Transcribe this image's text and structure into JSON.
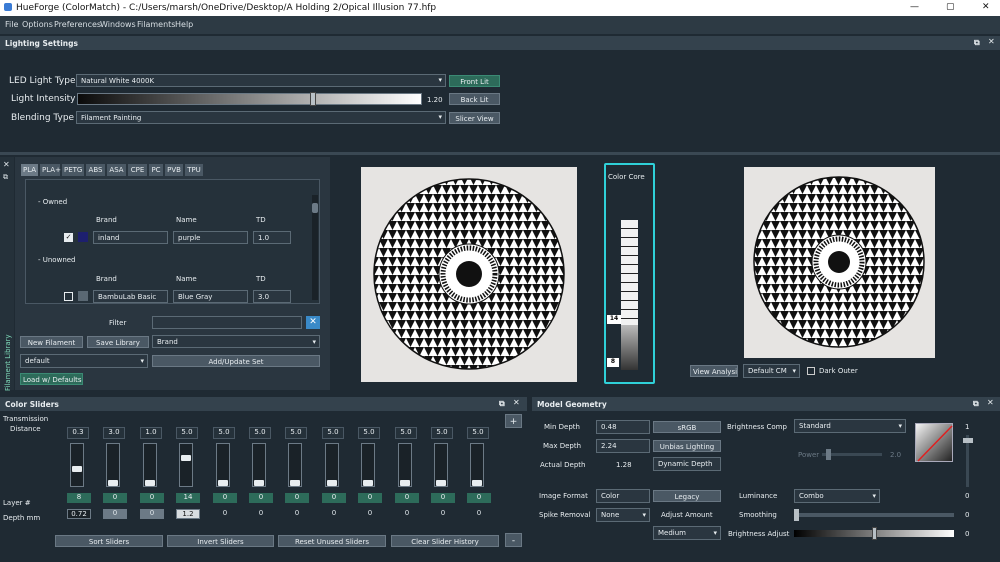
{
  "window": {
    "title": "HueForge (ColorMatch) - C:/Users/marsh/OneDrive/Desktop/A Holding 2/Opical Illusion 77.hfp",
    "minimize": "—",
    "maximize": "▢",
    "close": "✕"
  },
  "menu": [
    "File",
    "Options",
    "Preferences",
    "Windows",
    "Filaments",
    "Help"
  ],
  "lighting": {
    "header": "Lighting Settings",
    "led_label": "LED Light Type",
    "led_value": "Natural White 4000K",
    "intensity_label": "Light Intensity",
    "intensity_value": "1.20",
    "intensity_fraction": 0.68,
    "blending_label": "Blending Type",
    "blending_value": "Filament Painting",
    "btn_front": "Front Lit",
    "btn_back": "Back Lit",
    "btn_slicer": "Slicer View"
  },
  "library": {
    "side_label": "Filament Library",
    "tabs": [
      "PLA",
      "PLA+",
      "PETG",
      "ABS",
      "ASA",
      "CPE",
      "PC",
      "PVB",
      "TPU"
    ],
    "owned": "- Owned",
    "unowned": "- Unowned",
    "col_brand": "Brand",
    "col_name": "Name",
    "col_td": "TD",
    "owned_row": {
      "brand": "inland",
      "name": "purple",
      "td": "1.0",
      "color": "#1d1f6e"
    },
    "unowned_row": {
      "brand": "BambuLab Basic",
      "name": "Blue Gray",
      "td": "3.0",
      "color": "#5a6873"
    },
    "filter_label": "Filter",
    "btn_new": "New Filament",
    "btn_save": "Save Library",
    "sort_value": "Brand",
    "set_value": "default",
    "btn_addset": "Add/Update Set",
    "btn_load": "Load w/ Defaults"
  },
  "colorcore": {
    "label": "Color Core",
    "mark_top": "14",
    "mark_bottom": "8"
  },
  "analysis": {
    "btn": "View Analysis",
    "cm_value": "Default CM",
    "dark_outer": "Dark Outer"
  },
  "sliders": {
    "header": "Color Sliders",
    "trans_label": "Transmission",
    "dist_label": "Distance",
    "td_values": [
      "0.3",
      "3.0",
      "1.0",
      "5.0",
      "5.0",
      "5.0",
      "5.0",
      "5.0",
      "5.0",
      "5.0",
      "5.0",
      "5.0"
    ],
    "layer_label": "Layer #",
    "layers": [
      "8",
      "0",
      "0",
      "14",
      "0",
      "0",
      "0",
      "0",
      "0",
      "0",
      "0",
      "0"
    ],
    "depth_label": "Depth mm",
    "depths": [
      "0.72",
      "0",
      "0",
      "1.2",
      "0",
      "0",
      "0",
      "0",
      "0",
      "0",
      "0",
      "0"
    ],
    "btn_sort": "Sort Sliders",
    "btn_invert": "Invert Sliders",
    "btn_reset": "Reset Unused Sliders",
    "btn_clear": "Clear Slider History",
    "plus": "+",
    "minus": "-"
  },
  "geometry": {
    "header": "Model Geometry",
    "min_label": "Min Depth",
    "min_value": "0.48",
    "max_label": "Max Depth",
    "max_value": "2.24",
    "actual_label": "Actual Depth",
    "actual_value": "1.28",
    "btn_srgb": "sRGB",
    "btn_unbias": "Unbias Lighting",
    "dyn_value": "Dynamic Depth",
    "bcomp_label": "Brightness Comp",
    "bcomp_value": "Standard",
    "power_label": "Power",
    "power_value": "2.0",
    "img_label": "Image Format",
    "img_value": "Color",
    "btn_legacy": "Legacy",
    "spike_label": "Spike Removal",
    "spike_value": "None",
    "adjust_label": "Adjust Amount",
    "adjust_value": "Medium",
    "lum_label": "Luminance",
    "lum_value": "Combo",
    "smooth_label": "Smoothing",
    "smooth_value": "0",
    "badj_label": "Brightness Adjust",
    "badj_value": "0",
    "vert_top": "1",
    "vert_bottom": "0"
  }
}
